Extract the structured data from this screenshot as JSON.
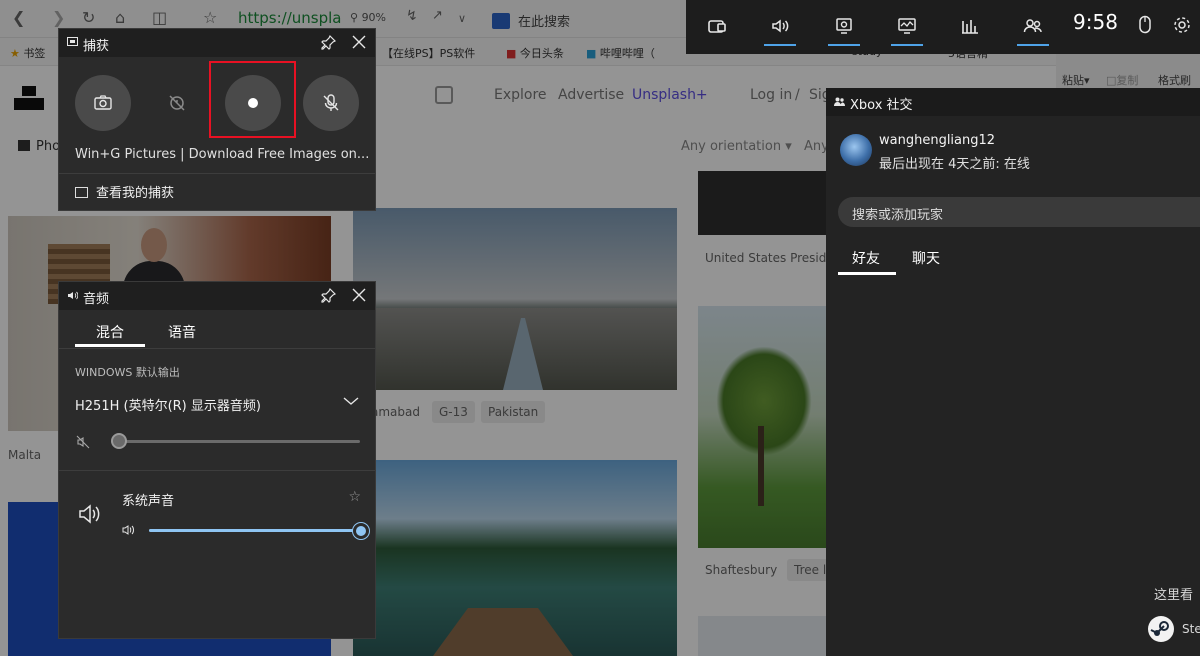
{
  "browser": {
    "url": "https://unspla",
    "zoom": "90%",
    "search_placeholder": "在此搜索",
    "bookmarks": [
      "书签",
      "【在线PS】PS软件",
      "今日头条",
      "哔哩哔哩（",
      "study",
      "5语言精"
    ],
    "site": {
      "nav": [
        "Explore",
        "Advertise",
        "Unsplash+",
        "Log in",
        "/",
        "Sig"
      ],
      "photos_tab": "Pho",
      "filters": [
        "Any orientation",
        "Any"
      ],
      "tags_col1": [
        "Malta"
      ],
      "tags_col2": [
        "amabad",
        "G-13",
        "Pakistan"
      ],
      "tags_col3_top": [
        "United States Preside"
      ],
      "tags_col3_bottom": [
        "Shaftesbury",
        "Tree l"
      ]
    },
    "ribbon": {
      "paste": "粘贴",
      "copy": "复制",
      "format": "格式刷"
    }
  },
  "gamebar": {
    "clock": "9:58",
    "buttons": [
      {
        "icon": "widget-menu-icon",
        "active": false
      },
      {
        "icon": "audio-icon",
        "active": true
      },
      {
        "icon": "capture-icon",
        "active": true
      },
      {
        "icon": "performance-icon",
        "active": true
      },
      {
        "icon": "resources-icon",
        "active": false
      },
      {
        "icon": "social-icon",
        "active": true
      }
    ],
    "accent": "#4fa3e8"
  },
  "capture": {
    "title": "捕获",
    "game_title": "Win+G Pictures | Download Free Images on...",
    "show_captures": "查看我的捕获",
    "highlight_color": "#e81123"
  },
  "audio": {
    "title": "音频",
    "tabs": [
      "混合",
      "语音"
    ],
    "windows_output_label": "WINDOWS 默认输出",
    "device": "H251H (英特尔(R) 显示器音频)",
    "device_volume": 0,
    "system_sounds": "系统声音",
    "system_volume": 100
  },
  "social": {
    "title": "Xbox 社交",
    "username": "wanghengliang12",
    "status": "最后出现在 4天之前: 在线",
    "search_placeholder": "搜索或添加玩家",
    "tabs": [
      "好友",
      "聊天"
    ],
    "hint": "这里看",
    "steam": "Ste"
  }
}
